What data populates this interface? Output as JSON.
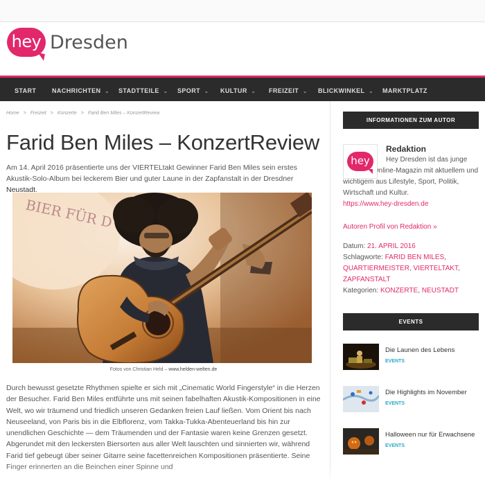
{
  "site": {
    "logo_word": "hey",
    "city": "Dresden",
    "brand_color": "#e2286a",
    "nav_color": "#2b2b2b",
    "link_color": "#e2286a",
    "category_color": "#2aa7c9"
  },
  "nav": {
    "items": [
      {
        "label": "START",
        "has_dropdown": false
      },
      {
        "label": "NACHRICHTEN",
        "has_dropdown": true
      },
      {
        "label": "STADTTEILE",
        "has_dropdown": true
      },
      {
        "label": "SPORT",
        "has_dropdown": true
      },
      {
        "label": "KULTUR",
        "has_dropdown": true
      },
      {
        "label": "FREIZEIT",
        "has_dropdown": true
      },
      {
        "label": "BLICKWINKEL",
        "has_dropdown": true
      },
      {
        "label": "MARKTPLATZ",
        "has_dropdown": false
      }
    ],
    "dropdown_icon": "chevron-down-icon"
  },
  "breadcrumb": {
    "home": "Home",
    "freizeit": "Freizeit",
    "konzerte": "Konzerte",
    "current": "Farid Ben Miles – KonzertReview",
    "separator": ">"
  },
  "article": {
    "title": "Farid Ben Miles – KonzertReview",
    "intro_text": "Am 14. April 2016 präsentierte uns der VIERTELtakt Gewinner Farid Ben Miles sein erstes Akustik-Solo-Album bei leckerem Bier und guter Laune in der Zapfanstalt in der Dresdner ",
    "intro_link": "Neustadt",
    "intro_end": ".",
    "photo_alt": "Musician playing acoustic guitar",
    "photo_sign_text": "BIER FÜR D",
    "caption_text": "Fotos von Christian Held – ",
    "caption_link": "www.helden-welten.de",
    "body_text": "Durch bewusst gesetzte Rhythmen spielte er sich mit „Cinematic World Fingerstyle“ in die Herzen der Besucher. Farid Ben Miles entführte uns mit seinen fabelhaften Akustik-Kompositionen in eine Welt, wo wir träumend und friedlich unseren Gedanken freien Lauf ließen. Vom Orient bis nach Neuseeland, von Paris bis in die Elbflorenz, vom Takka-Tukka-Abenteuerland bis hin zur unendlichen Geschichte — dem Träumenden und der Fantasie waren keine Grenzen gesetzt. Abgerundet mit den leckersten Biersorten aus aller Welt lauschten und sinnierten wir, während Farid tief gebeugt über seiner Gitarre seine facettenreichen Kompositionen präsentierte. Seine Finger erinnerten an die Beinchen einer Spinne und"
  },
  "sidebar": {
    "author_widget_title": "INFORMATIONEN ZUM AUTOR",
    "author_avatar_word": "hey",
    "author_name": "Redaktion",
    "author_bio": "Hey Dresden ist das junge Dresdner Online-Magazin mit aktuellem und wichtigem aus Lifestyle, Sport, Politik, Wirtschaft und Kultur.",
    "author_url": "https://www.hey-dresden.de",
    "profile_link": "Autoren Profil von Redaktion »",
    "date_label": "Datum:",
    "date_value": "21. APRIL 2016",
    "tags_label": "Schlagworte:",
    "tags": [
      "FARID BEN MILES",
      "QUARTIERMEISTER",
      "VIERTELTAKT",
      "ZAPFANSTALT"
    ],
    "categories_label": "Kategorien:",
    "categories": [
      "KONZERTE",
      "NEUSTADT"
    ],
    "events_widget_title": "EVENTS",
    "events": [
      {
        "title": "Die Launen des Lebens",
        "category": "EVENTS"
      },
      {
        "title": "Die Highlights im November",
        "category": "EVENTS"
      },
      {
        "title": "Halloween nur für Erwachsene",
        "category": "EVENTS"
      }
    ]
  }
}
